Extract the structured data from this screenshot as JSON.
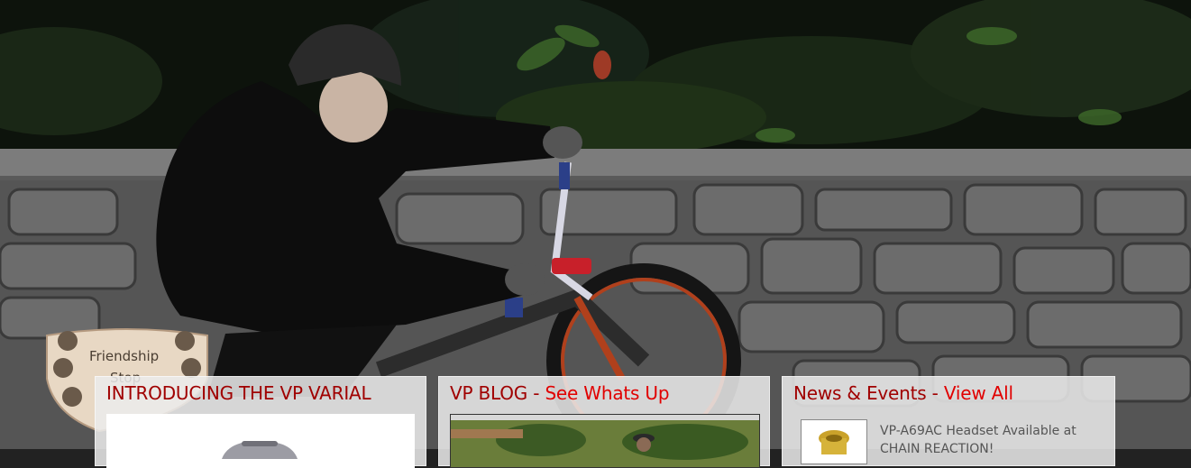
{
  "hero": {
    "sign_text": [
      "Friendship",
      "Stop"
    ]
  },
  "panels": {
    "variant": {
      "title": "INTRODUCING THE VP VARIAL"
    },
    "blog": {
      "title_main": "VP BLOG - ",
      "title_link": "See Whats Up"
    },
    "news": {
      "title_main": "News & Events - ",
      "title_link": "View All",
      "items": [
        {
          "text": "VP-A69AC Headset Available at CHAIN REACTION!"
        }
      ]
    }
  }
}
